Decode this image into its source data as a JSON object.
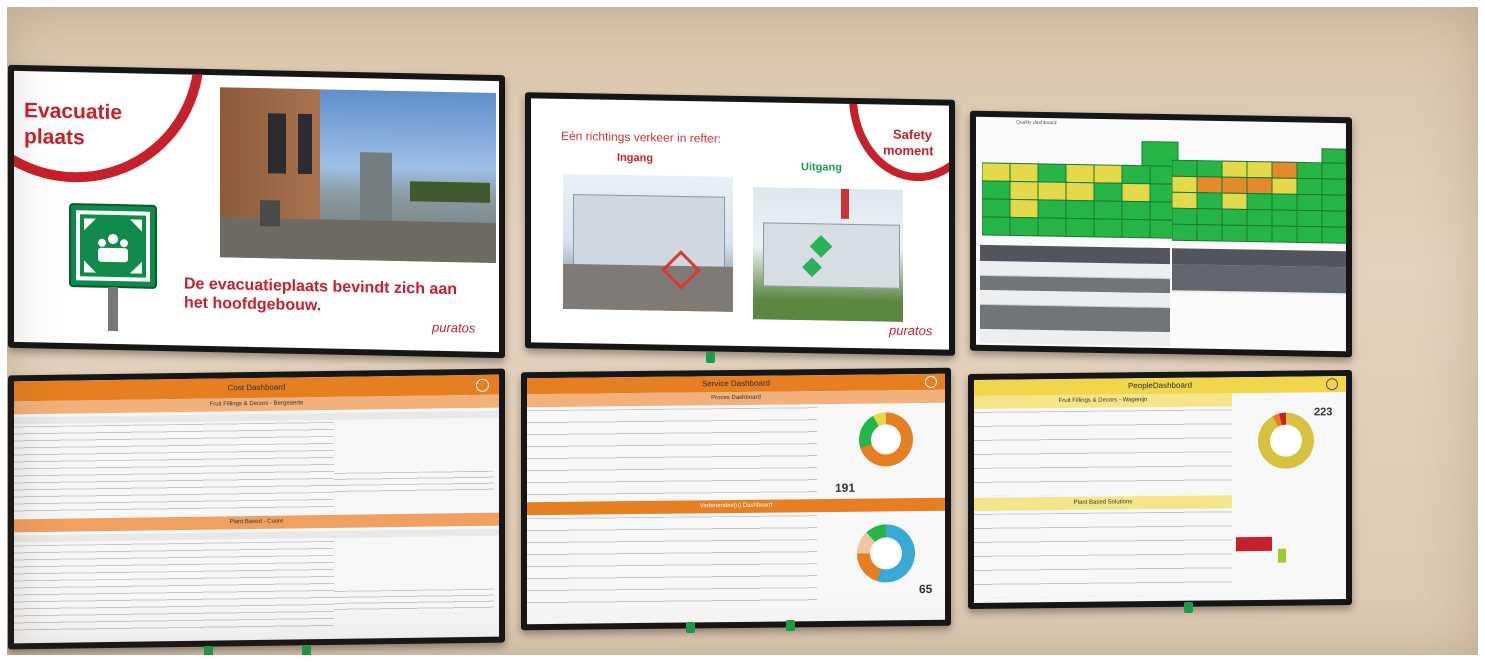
{
  "screen1": {
    "title_line1": "Evacuatie",
    "title_line2": "plaats",
    "caption_line1": "De evacuatieplaats bevindt zich aan",
    "caption_line2": "het hoofdgebouw.",
    "logo": "puratos",
    "sign_icon": "assembly-point-icon"
  },
  "screen2": {
    "heading": "Eén richtings verkeer in refter:",
    "entrance_label": "Ingang",
    "exit_label": "Uitgang",
    "badge_line1": "Safety",
    "badge_line2": "moment",
    "logo": "puratos"
  },
  "screen3": {
    "label": "Quality dashboard"
  },
  "screen4": {
    "title": "Cost Dashboard",
    "section1": "Fruit Fillings & Decors - Bergeaerte",
    "section2": "Plant Based - Cuore"
  },
  "screen5": {
    "title": "Service Dashboard",
    "section1": "Proces Dashboard",
    "section2": "Verbeteridee(n) Dashboard",
    "kpi1": "191",
    "kpi2": "65"
  },
  "screen6": {
    "title": "PeopleDashboard",
    "section1": "Fruit Fillings & Decors - Wagenijn",
    "section2": "Plant Based Solutions",
    "kpi": "223"
  },
  "colors": {
    "brand_red": "#c8202a",
    "cost_orange": "#e67e22",
    "people_yellow": "#efd64a",
    "grid_green": "#27b548"
  }
}
